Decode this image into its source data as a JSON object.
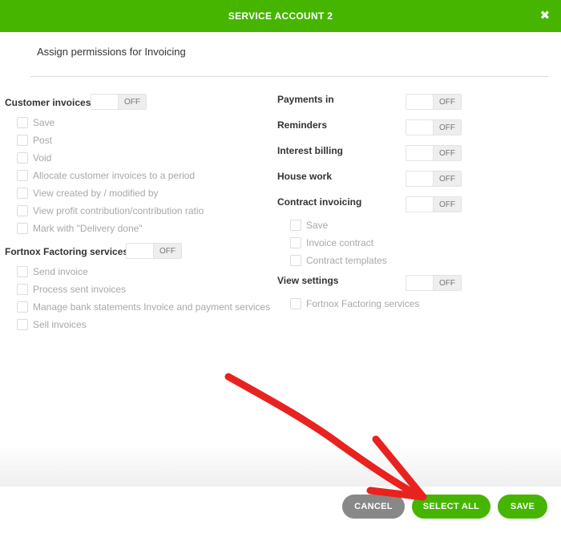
{
  "header": {
    "title": "SERVICE ACCOUNT 2",
    "close_icon": "close-icon"
  },
  "subtitle": "Assign permissions for Invoicing",
  "toggle_off_label": "OFF",
  "left_col": {
    "customer_invoices": {
      "title": "Customer invoices",
      "items": [
        "Save",
        "Post",
        "Void",
        "Allocate customer invoices to a period",
        "View created by / modified by",
        "View profit contribution/contribution ratio",
        "Mark with \"Delivery done\""
      ]
    },
    "factoring": {
      "title": "Fortnox Factoring services",
      "items": [
        "Send invoice",
        "Process sent invoices",
        "Manage bank statements Invoice and payment services",
        "Sell invoices"
      ]
    }
  },
  "right_col": {
    "payments_in": {
      "title": "Payments in"
    },
    "reminders": {
      "title": "Reminders"
    },
    "interest_billing": {
      "title": "Interest billing"
    },
    "house_work": {
      "title": "House work"
    },
    "contract_invoicing": {
      "title": "Contract invoicing",
      "items": [
        "Save",
        "Invoice contract",
        "Contract templates"
      ]
    },
    "view_settings": {
      "title": "View settings",
      "items": [
        "Fortnox Factoring services"
      ]
    }
  },
  "footer": {
    "cancel": "CANCEL",
    "select_all": "SELECT ALL",
    "save": "SAVE"
  },
  "colors": {
    "brand_green": "#46b500",
    "cancel_gray": "#888888",
    "arrow_red": "#e8231f"
  }
}
